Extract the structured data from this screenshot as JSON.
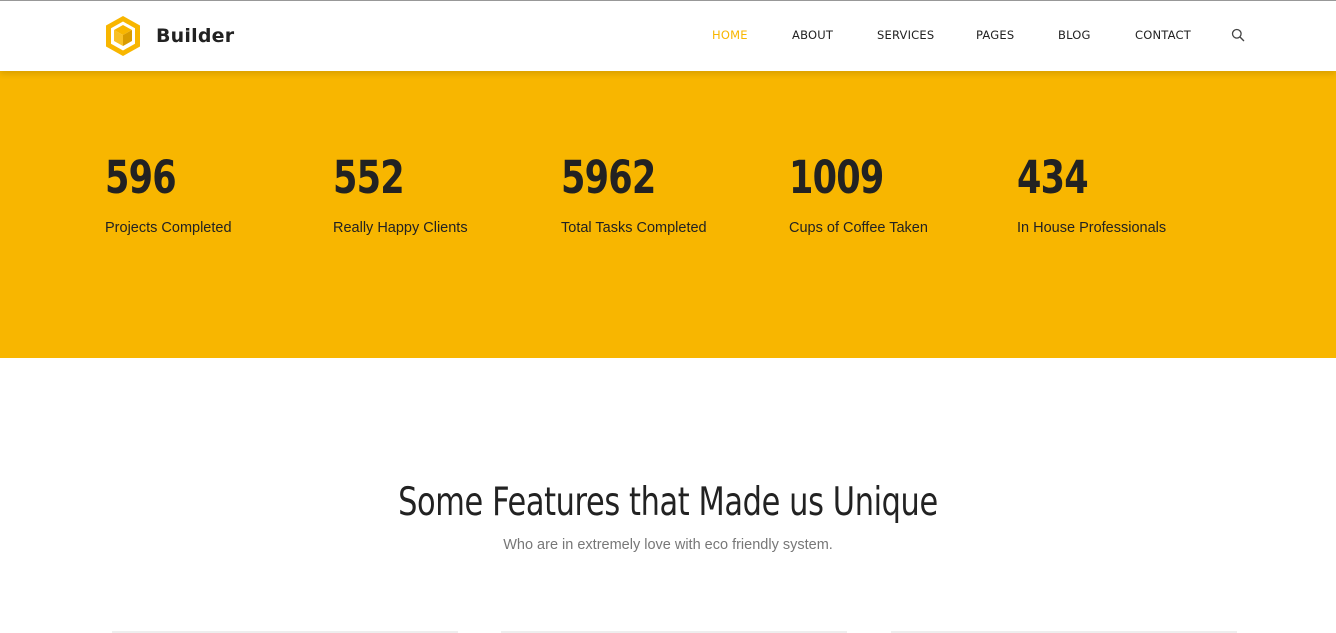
{
  "brand": {
    "name": "Builder",
    "accent": "#f8b600"
  },
  "nav": {
    "items": [
      {
        "label": "HOME",
        "active": true
      },
      {
        "label": "ABOUT",
        "active": false
      },
      {
        "label": "SERVICES",
        "active": false
      },
      {
        "label": "PAGES",
        "active": false
      },
      {
        "label": "BLOG",
        "active": false
      },
      {
        "label": "CONTACT",
        "active": false
      }
    ],
    "search_icon": "search-icon"
  },
  "stats": [
    {
      "value": "596",
      "label": "Projects Completed"
    },
    {
      "value": "552",
      "label": "Really Happy Clients"
    },
    {
      "value": "5962",
      "label": "Total Tasks Completed"
    },
    {
      "value": "1009",
      "label": "Cups of Coffee Taken"
    },
    {
      "value": "434",
      "label": "In House Professionals"
    }
  ],
  "features": {
    "title": "Some Features that Made us Unique",
    "subtitle": "Who are in extremely love with eco friendly system."
  },
  "colors": {
    "stats_bg": "#f8b600",
    "text_dark": "#222222",
    "text_muted": "#777777"
  }
}
